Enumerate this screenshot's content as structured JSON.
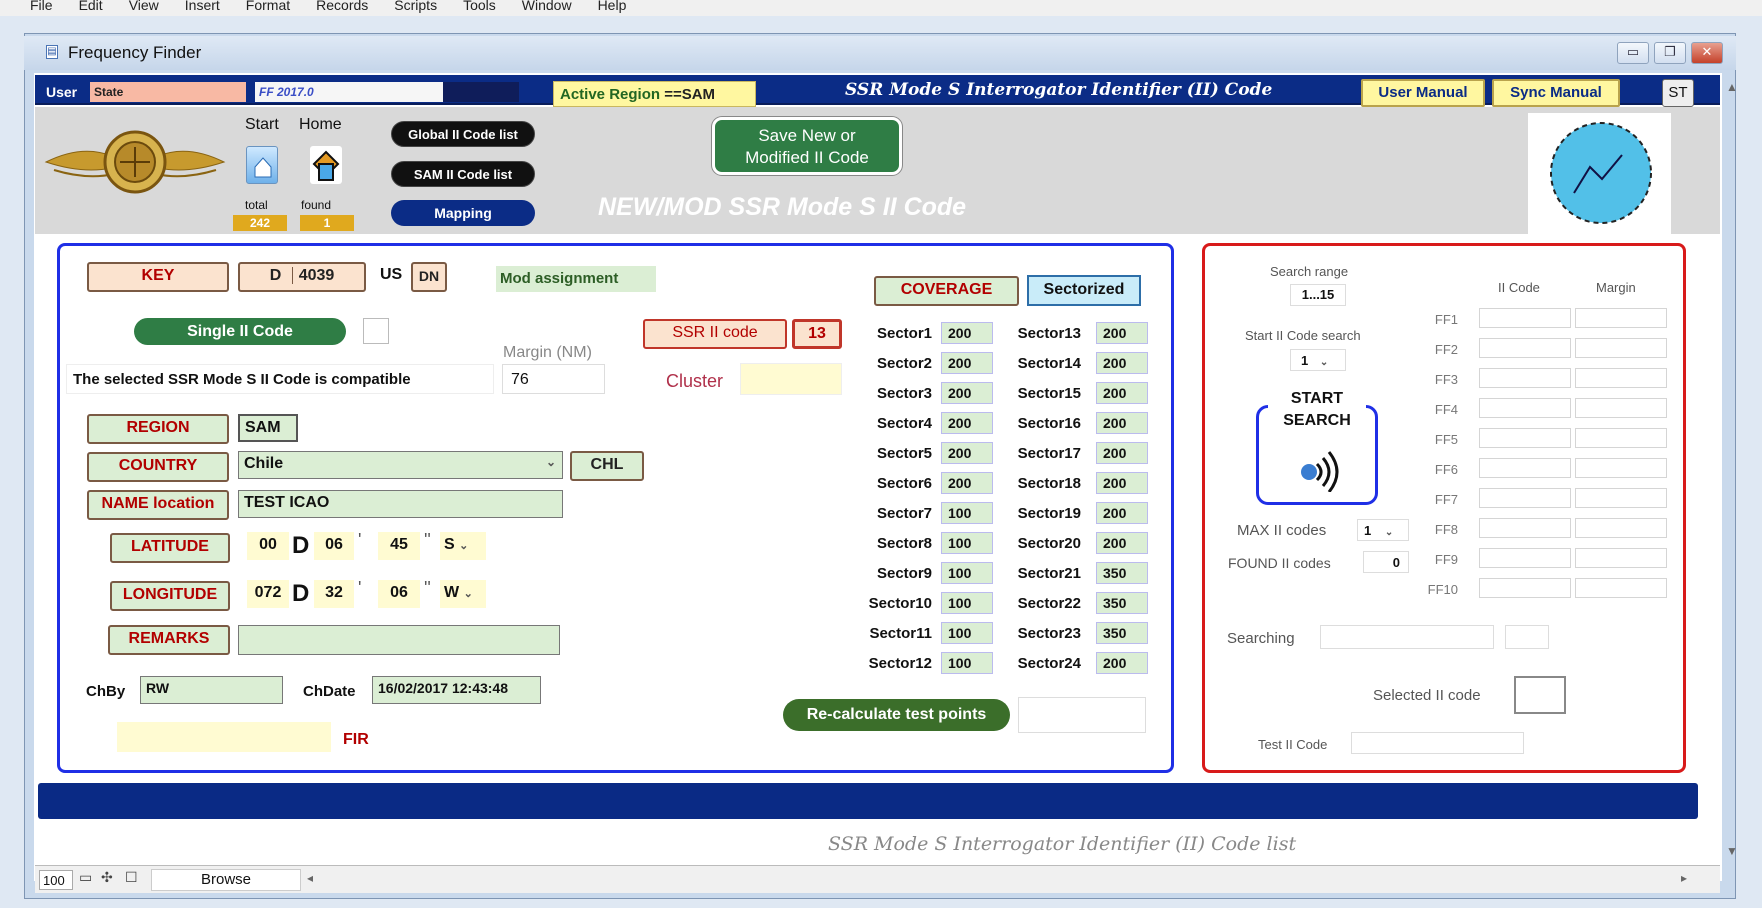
{
  "menubar": {
    "items": [
      "File",
      "Edit",
      "View",
      "Insert",
      "Format",
      "Records",
      "Scripts",
      "Tools",
      "Window",
      "Help"
    ]
  },
  "window": {
    "title": "Frequency Finder",
    "minimize_icon": "minimize-icon",
    "restore_icon": "restore-icon",
    "close_icon": "close-icon"
  },
  "header": {
    "user_label": "User",
    "user_value": "State",
    "version": "FF 2017.0",
    "active_region_label": "Active Region",
    "active_region_value": "==SAM",
    "title": "SSR Mode S Interrogator Identifier (II) Code",
    "user_manual": "User Manual",
    "sync_manual": "Sync Manual",
    "st_button": "ST"
  },
  "toolbar": {
    "start_label": "Start",
    "home_label": "Home",
    "total_label": "total",
    "found_label": "found",
    "total_value": "242",
    "found_value": "1",
    "global_list": "Global II Code list",
    "sam_list": "SAM II Code list",
    "mapping": "Mapping",
    "save_line1": "Save New or",
    "save_line2": "Modified II Code",
    "page_heading": "NEW/MOD SSR Mode S II Code"
  },
  "form": {
    "key_label": "KEY",
    "key_prefix": "D",
    "key_value": "4039",
    "us_label": "US",
    "dn_value": "DN",
    "mod_assignment": "Mod assignment",
    "single_ii_code": "Single II Code",
    "margin_label": "Margin (NM)",
    "compat_text": "The selected SSR Mode S II Code is compatible",
    "margin_value": "76",
    "ssr_ii_code_label": "SSR II code",
    "ssr_ii_code_value": "13",
    "cluster_label": "Cluster",
    "region_label": "REGION",
    "region_value": "SAM",
    "country_label": "COUNTRY",
    "country_value": "Chile",
    "country_code": "CHL",
    "name_label": "NAME location",
    "name_value": "TEST ICAO",
    "latitude_label": "LATITUDE",
    "lat_deg": "00",
    "lat_min": "06",
    "lat_sec": "45",
    "lat_hem": "S",
    "longitude_label": "LONGITUDE",
    "lon_deg": "072",
    "lon_min": "32",
    "lon_sec": "06",
    "lon_hem": "W",
    "d_symbol": "D",
    "min_symbol": "'",
    "sec_symbol": "''",
    "remarks_label": "REMARKS",
    "chby_label": "ChBy",
    "chby_value": "RW",
    "chdate_label": "ChDate",
    "chdate_value": "16/02/2017 12:43:48",
    "fir_label": "FIR",
    "coverage": "COVERAGE",
    "sectorized": "Sectorized",
    "recalc": "Re-calculate test points"
  },
  "sectors_left": [
    {
      "label": "Sector1",
      "value": "200"
    },
    {
      "label": "Sector2",
      "value": "200"
    },
    {
      "label": "Sector3",
      "value": "200"
    },
    {
      "label": "Sector4",
      "value": "200"
    },
    {
      "label": "Sector5",
      "value": "200"
    },
    {
      "label": "Sector6",
      "value": "200"
    },
    {
      "label": "Sector7",
      "value": "100"
    },
    {
      "label": "Sector8",
      "value": "100"
    },
    {
      "label": "Sector9",
      "value": "100"
    },
    {
      "label": "Sector10",
      "value": "100"
    },
    {
      "label": "Sector11",
      "value": "100"
    },
    {
      "label": "Sector12",
      "value": "100"
    }
  ],
  "sectors_right": [
    {
      "label": "Sector13",
      "value": "200"
    },
    {
      "label": "Sector14",
      "value": "200"
    },
    {
      "label": "Sector15",
      "value": "200"
    },
    {
      "label": "Sector16",
      "value": "200"
    },
    {
      "label": "Sector17",
      "value": "200"
    },
    {
      "label": "Sector18",
      "value": "200"
    },
    {
      "label": "Sector19",
      "value": "200"
    },
    {
      "label": "Sector20",
      "value": "200"
    },
    {
      "label": "Sector21",
      "value": "350"
    },
    {
      "label": "Sector22",
      "value": "350"
    },
    {
      "label": "Sector23",
      "value": "350"
    },
    {
      "label": "Sector24",
      "value": "200"
    }
  ],
  "search": {
    "range_label": "Search range",
    "range_value": "1...15",
    "ii_code_header": "II Code",
    "margin_header": "Margin",
    "start_label": "Start II Code search",
    "start_value": "1",
    "start_search_line1": "START",
    "start_search_line2": "SEARCH",
    "max_label": "MAX II codes",
    "max_value": "1",
    "found_label": "FOUND II codes",
    "found_value": "0",
    "ff_labels": [
      "FF1",
      "FF2",
      "FF3",
      "FF4",
      "FF5",
      "FF6",
      "FF7",
      "FF8",
      "FF9",
      "FF10"
    ],
    "searching_label": "Searching",
    "selected_label": "Selected II code",
    "test_label": "Test II Code"
  },
  "footer": {
    "list_title": "SSR Mode S Interrogator Identifier (II) Code list",
    "zoom": "100",
    "mode": "Browse"
  }
}
